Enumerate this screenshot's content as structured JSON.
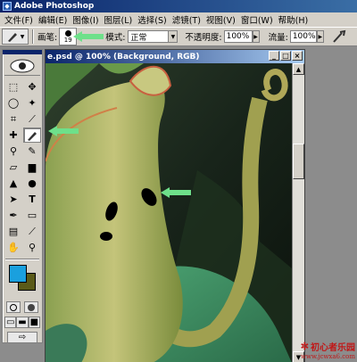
{
  "app": {
    "title": "Adobe Photoshop",
    "logo_letters": "Ps"
  },
  "menu": [
    "文件(F)",
    "编辑(E)",
    "图像(I)",
    "图层(L)",
    "选择(S)",
    "滤镜(T)",
    "视图(V)",
    "窗口(W)",
    "帮助(H)"
  ],
  "options": {
    "brush_label": "画笔:",
    "brush_size": "19",
    "mode_label": "模式:",
    "mode_value": "正常",
    "opacity_label": "不透明度:",
    "opacity_value": "100%",
    "flow_label": "流量:",
    "flow_value": "100%"
  },
  "document": {
    "title": "e.psd @ 100% (Background, RGB)"
  },
  "colors": {
    "foreground": "#1aa0de",
    "background": "#5a5a18",
    "accent_arrow": "#6ee08a"
  },
  "watermark": {
    "brand": "初心者乐园",
    "url": "www.jcwxa6.com"
  }
}
